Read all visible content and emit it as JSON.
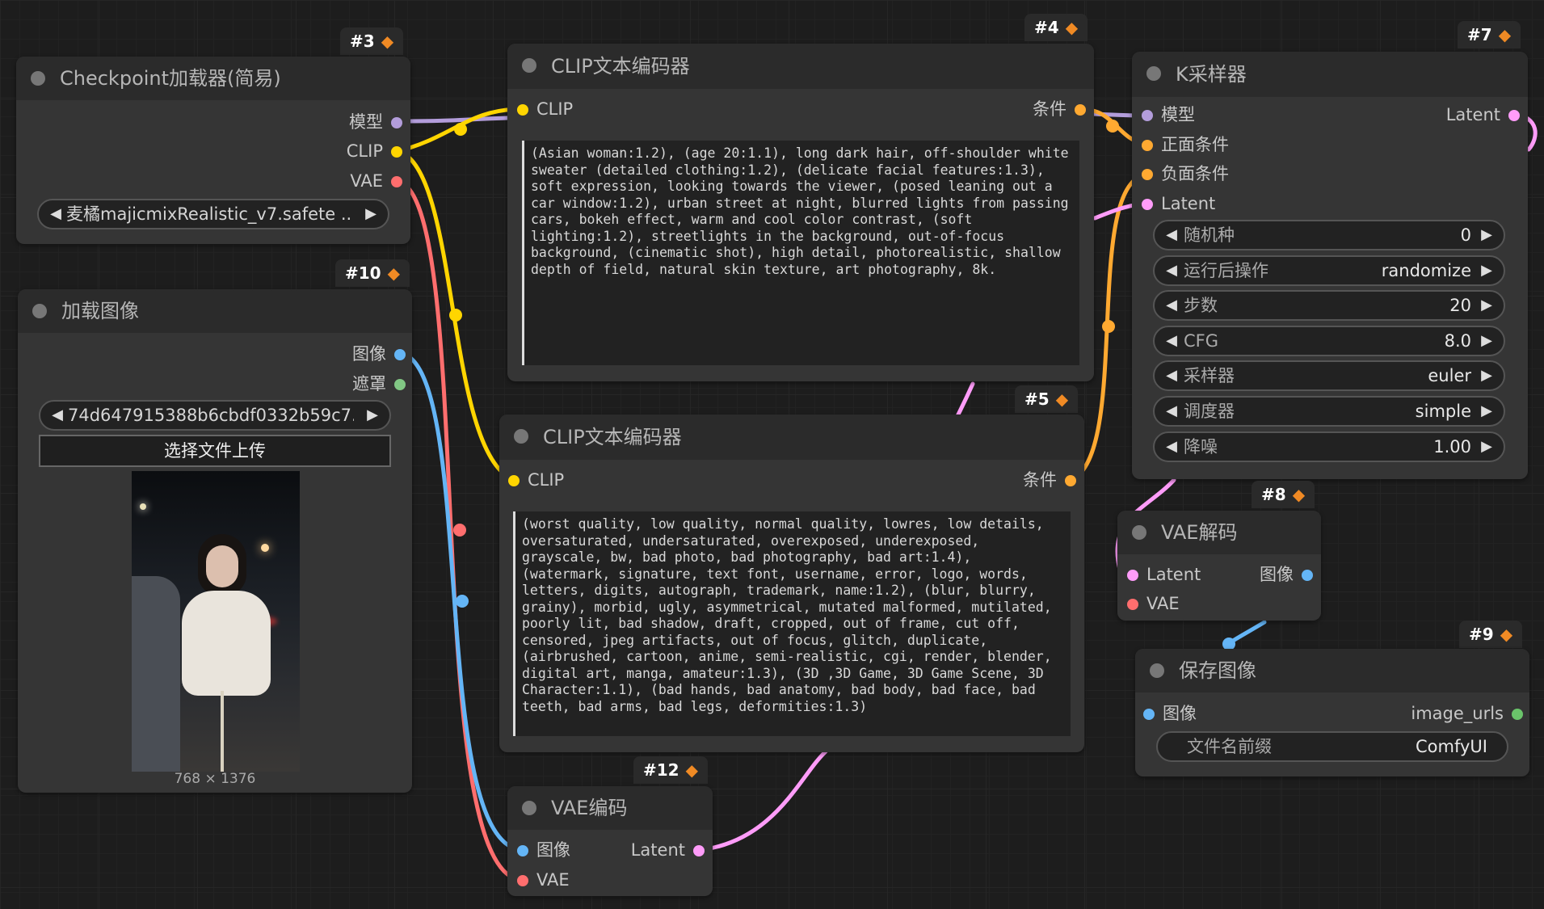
{
  "colors": {
    "model": "#b39ddb",
    "clip": "#ffd500",
    "vae": "#ff6e6e",
    "image": "#64b5f6",
    "mask": "#81c784",
    "conditioning": "#ffa931",
    "latent": "#ff9cf9",
    "string": "#6ac46a"
  },
  "nodes": {
    "checkpoint": {
      "badge": "#3",
      "title": "Checkpoint加载器(简易)",
      "outputs": [
        "模型",
        "CLIP",
        "VAE"
      ],
      "ckpt_value": "麦橘majicmixRealistic_v7.safete ..."
    },
    "load_image": {
      "badge": "#10",
      "title": "加载图像",
      "outputs": [
        "图像",
        "遮罩"
      ],
      "image_value": "74d647915388b6cbdf0332b59c7...",
      "upload_label": "选择文件上传",
      "image_size": "768 × 1376"
    },
    "clip_pos": {
      "badge": "#4",
      "title": "CLIP文本编码器",
      "input": "CLIP",
      "output": "条件",
      "text": "(Asian woman:1.2), (age 20:1.1), long dark hair, off-shoulder white sweater (detailed clothing:1.2), (delicate facial features:1.3), soft expression, looking towards the viewer, (posed leaning out a car window:1.2), urban street at night, blurred lights from passing cars, bokeh effect, warm and cool color contrast, (soft lighting:1.2), streetlights in the background, out-of-focus background, (cinematic shot), high detail, photorealistic, shallow depth of field, natural skin texture, art photography, 8k."
    },
    "clip_neg": {
      "badge": "#5",
      "title": "CLIP文本编码器",
      "input": "CLIP",
      "output": "条件",
      "text": "(worst quality, low quality, normal quality, lowres, low details, oversaturated, undersaturated, overexposed, underexposed, grayscale, bw, bad photo, bad photography, bad art:1.4), (watermark, signature, text font, username, error, logo, words, letters, digits, autograph, trademark, name:1.2), (blur, blurry, grainy), morbid, ugly, asymmetrical, mutated malformed, mutilated, poorly lit, bad shadow, draft, cropped, out of frame, cut off, censored, jpeg artifacts, out of focus, glitch, duplicate, (airbrushed, cartoon, anime, semi-realistic, cgi, render, blender, digital art, manga, amateur:1.3), (3D ,3D Game, 3D Game Scene, 3D Character:1.1), (bad hands, bad anatomy, bad body, bad face, bad teeth, bad arms, bad legs, deformities:1.3)"
    },
    "ksampler": {
      "badge": "#7",
      "title": "K采样器",
      "inputs": [
        "模型",
        "正面条件",
        "负面条件",
        "Latent"
      ],
      "output": "Latent",
      "widgets": [
        {
          "label": "随机种",
          "value": "0"
        },
        {
          "label": "运行后操作",
          "value": "randomize"
        },
        {
          "label": "步数",
          "value": "20"
        },
        {
          "label": "CFG",
          "value": "8.0"
        },
        {
          "label": "采样器",
          "value": "euler"
        },
        {
          "label": "调度器",
          "value": "simple"
        },
        {
          "label": "降噪",
          "value": "1.00"
        }
      ]
    },
    "vae_decode": {
      "badge": "#8",
      "title": "VAE解码",
      "inputs": [
        "Latent",
        "VAE"
      ],
      "output": "图像"
    },
    "save_image": {
      "badge": "#9",
      "title": "保存图像",
      "input": "图像",
      "output": "image_urls",
      "prefix_label": "文件名前缀",
      "prefix_value": "ComfyUI"
    },
    "vae_encode": {
      "badge": "#12",
      "title": "VAE编码",
      "inputs": [
        "图像",
        "VAE"
      ],
      "output": "Latent"
    }
  }
}
